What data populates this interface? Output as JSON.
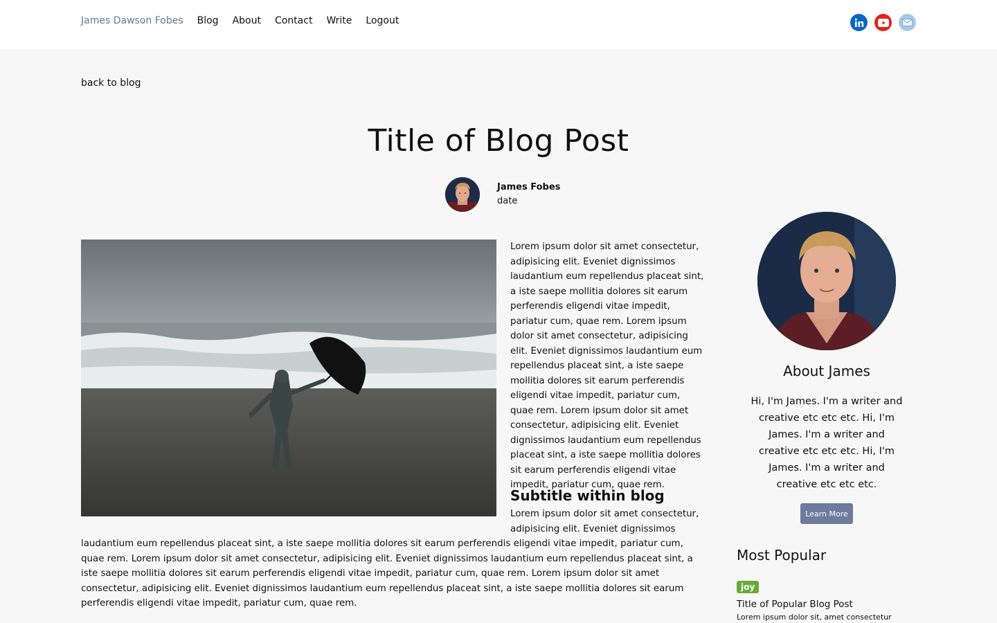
{
  "nav": {
    "brand": "James Dawson Fobes",
    "links": [
      "Blog",
      "About",
      "Contact",
      "Write",
      "Logout"
    ]
  },
  "socials": [
    {
      "icon": "linkedin-icon",
      "color": "#0a66c2"
    },
    {
      "icon": "youtube-icon",
      "color": "#e62117"
    },
    {
      "icon": "mail-icon",
      "color": "#a9c8e6"
    }
  ],
  "post": {
    "back_label": "back to blog",
    "title": "Title of Blog Post",
    "author": "James Fobes",
    "date": "date",
    "paragraph1": "Lorem ipsum dolor sit amet consectetur, adipisicing elit. Eveniet dignissimos laudantium eum repellendus placeat sint, a iste saepe mollitia dolores sit earum perferendis eligendi vitae impedit, pariatur cum, quae rem. Lorem ipsum dolor sit amet consectetur, adipisicing elit. Eveniet dignissimos laudantium eum repellendus placeat sint, a iste saepe mollitia dolores sit earum perferendis eligendi vitae impedit, pariatur cum, quae rem. Lorem ipsum dolor sit amet consectetur, adipisicing elit. Eveniet dignissimos laudantium eum repellendus placeat sint, a iste saepe mollitia dolores sit earum perferendis eligendi vitae impedit, pariatur cum, quae rem.",
    "subtitle": "Subtitle within blog",
    "paragraph2_start": "Lorem ipsum dolor sit amet consectetur, adipisicing elit. Eveniet dignissimos",
    "paragraph2_rest": "laudantium eum repellendus placeat sint, a iste saepe mollitia dolores sit earum perferendis eligendi vitae impedit, pariatur cum, quae rem. Lorem ipsum dolor sit amet consectetur, adipisicing elit. Eveniet dignissimos laudantium eum repellendus placeat sint, a iste saepe mollitia dolores sit earum perferendis eligendi vitae impedit, pariatur cum, quae rem. Lorem ipsum dolor sit amet consectetur, adipisicing elit. Eveniet dignissimos laudantium eum repellendus placeat sint, a iste saepe mollitia dolores sit earum perferendis eligendi vitae impedit, pariatur cum, quae rem."
  },
  "sidebar": {
    "about_title": "About James",
    "about_text": "Hi, I'm James. I'm a writer and creative etc etc etc. Hi, I'm James. I'm a writer and creative etc etc etc. Hi, I'm James. I'm a writer and creative etc etc etc.",
    "learn_more": "Learn More",
    "popular_title": "Most Popular",
    "popular_post": {
      "tag": "joy",
      "title": "Title of Popular Blog Post",
      "excerpt": "Lorem ipsum dolor sit, amet consectetur"
    }
  }
}
